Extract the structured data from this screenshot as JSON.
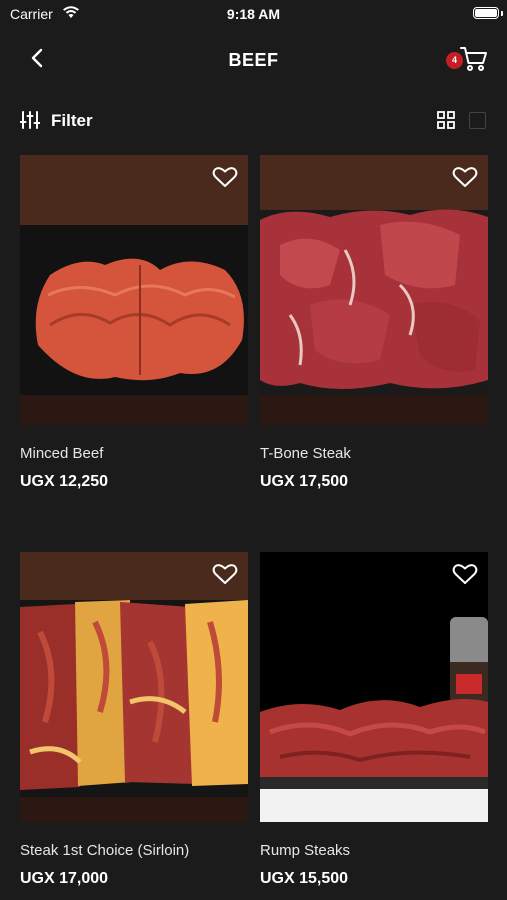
{
  "status": {
    "carrier": "Carrier",
    "time": "9:18 AM"
  },
  "header": {
    "title": "BEEF",
    "cart_count": "4"
  },
  "toolbar": {
    "filter_label": "Filter"
  },
  "products": [
    {
      "name": "Minced Beef",
      "price": "UGX 12,250"
    },
    {
      "name": "T-Bone Steak",
      "price": "UGX 17,500"
    },
    {
      "name": "Steak 1st Choice (Sirloin)",
      "price": "UGX 17,000"
    },
    {
      "name": "Rump Steaks",
      "price": "UGX 15,500"
    }
  ],
  "colors": {
    "background": "#1b1b1b",
    "badge": "#c41e24",
    "text": "#ffffff"
  },
  "icons": [
    "wifi-icon",
    "battery-icon",
    "back-arrow-icon",
    "cart-icon",
    "filter-sliders-icon",
    "grid-view-icon",
    "single-view-icon",
    "heart-icon"
  ]
}
